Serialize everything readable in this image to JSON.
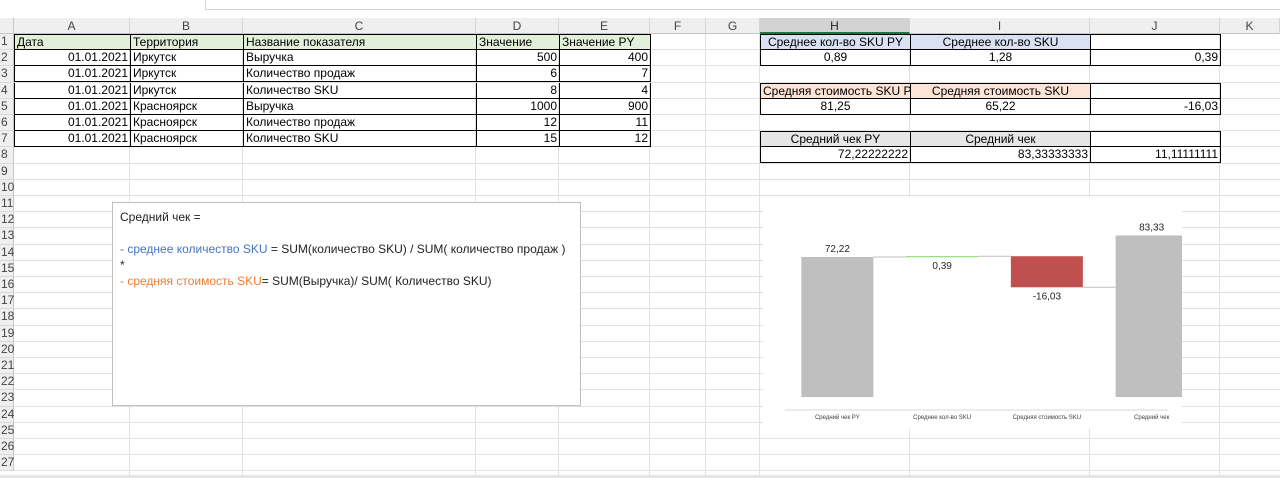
{
  "columns": [
    "A",
    "B",
    "C",
    "D",
    "E",
    "F",
    "G",
    "H",
    "I",
    "J",
    "K"
  ],
  "selected_column": "H",
  "rows": [
    "1",
    "2",
    "3",
    "4",
    "5",
    "6",
    "7",
    "8",
    "9",
    "10",
    "11",
    "12",
    "13",
    "14",
    "15",
    "16",
    "17",
    "18",
    "19",
    "20",
    "21",
    "22",
    "23",
    "24",
    "25",
    "26",
    "27"
  ],
  "source_table": {
    "headers": [
      "Дата",
      "Территория",
      "Название показателя",
      "Значение",
      "Значение PY"
    ],
    "rows": [
      [
        "01.01.2021",
        "Иркутск",
        "Выручка",
        "500",
        "400"
      ],
      [
        "01.01.2021",
        "Иркутск",
        "Количество продаж",
        "6",
        "7"
      ],
      [
        "01.01.2021",
        "Иркутск",
        "Количество SKU",
        "8",
        "4"
      ],
      [
        "01.01.2021",
        "Красноярск",
        "Выручка",
        "1000",
        "900"
      ],
      [
        "01.01.2021",
        "Красноярск",
        "Количество продаж",
        "12",
        "11"
      ],
      [
        "01.01.2021",
        "Красноярск",
        "Количество SKU",
        "15",
        "12"
      ]
    ]
  },
  "calc": {
    "sku_count": {
      "h_label": "Среднее кол-во SKU PY",
      "i_label": "Среднее кол-во SKU",
      "h_val": "0,89",
      "i_val": "1,28",
      "j_val": "0,39"
    },
    "sku_cost": {
      "h_label": "Средняя стоимость SKU PY",
      "i_label": "Средняя стоимость SKU",
      "h_val": "81,25",
      "i_val": "65,22",
      "j_val": "-16,03"
    },
    "avg_check": {
      "h_label": "Средний чек PY",
      "i_label": "Средний чек",
      "h_val": "72,22222222",
      "i_val": "83,33333333",
      "j_val": "11,11111111"
    }
  },
  "textbox": {
    "line1": "Средний чек =",
    "line2_colored": "- среднее количество SKU",
    "line2_rest": " = SUM(количество SKU) / SUM( количество продаж )",
    "line3": "*",
    "line4_colored": "- средняя стоимость SKU",
    "line4_rest": "= SUM(Выручка)/ SUM( Количество SKU)"
  },
  "chart_data": {
    "type": "bar",
    "subtype": "waterfall",
    "categories": [
      "Средний чек PY",
      "Среднее кол-во SKU",
      "Средняя стоимость SKU",
      "Средний чек"
    ],
    "values": [
      72.22,
      0.39,
      -16.03,
      83.33
    ],
    "data_labels": [
      "72,22",
      "0,39",
      "-16,03",
      "83,33"
    ],
    "series_types": [
      "total",
      "increase",
      "decrease",
      "total"
    ],
    "colors": {
      "total": "#bfbfbf",
      "increase": "#7fd45f",
      "decrease": "#c0504d"
    },
    "ylim": [
      0,
      100
    ],
    "legend": "none",
    "grid": false
  },
  "colors": {
    "header_green": "#e2efda",
    "header_blue": "#d9e1f2",
    "header_peach": "#fce4d6",
    "header_gray": "#e7e6e6",
    "selection": "#217346"
  }
}
